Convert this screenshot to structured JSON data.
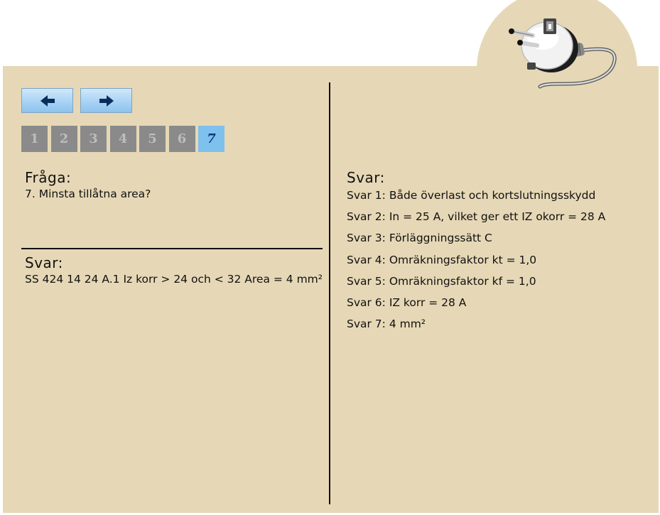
{
  "navigation": {
    "prev_icon": "arrow-left-icon",
    "next_icon": "arrow-right-icon"
  },
  "pages": [
    {
      "label": "1",
      "active": false
    },
    {
      "label": "2",
      "active": false
    },
    {
      "label": "3",
      "active": false
    },
    {
      "label": "4",
      "active": false
    },
    {
      "label": "5",
      "active": false
    },
    {
      "label": "6",
      "active": false
    },
    {
      "label": "7",
      "active": true
    }
  ],
  "question": {
    "heading": "Fråga:",
    "text": "7. Minsta tillåtna area?"
  },
  "answer": {
    "heading": "Svar:",
    "text": "SS 424 14 24 A.1 Iz korr > 24 och < 32  Area = 4 mm²"
  },
  "answers_summary": {
    "heading": "Svar:",
    "items": [
      "Svar 1: Både överlast och kortslutningsskydd",
      "Svar 2: In = 25 A, vilket ger ett IZ okorr = 28 A",
      "Svar 3: Förläggningssätt C",
      "Svar 4: Omräkningsfaktor kt = 1,0",
      "Svar 5: Omräkningsfaktor kf = 1,0",
      "Svar 6: IZ korr = 28 A",
      "Svar 7: 4 mm²"
    ]
  },
  "colors": {
    "panel_background": "#e6d8b6",
    "page_button": "#8a8a8a",
    "page_button_active": "#7ec0ee",
    "nav_button": "#a9d3f5"
  },
  "logo_icon": "electrical-plug-icon"
}
